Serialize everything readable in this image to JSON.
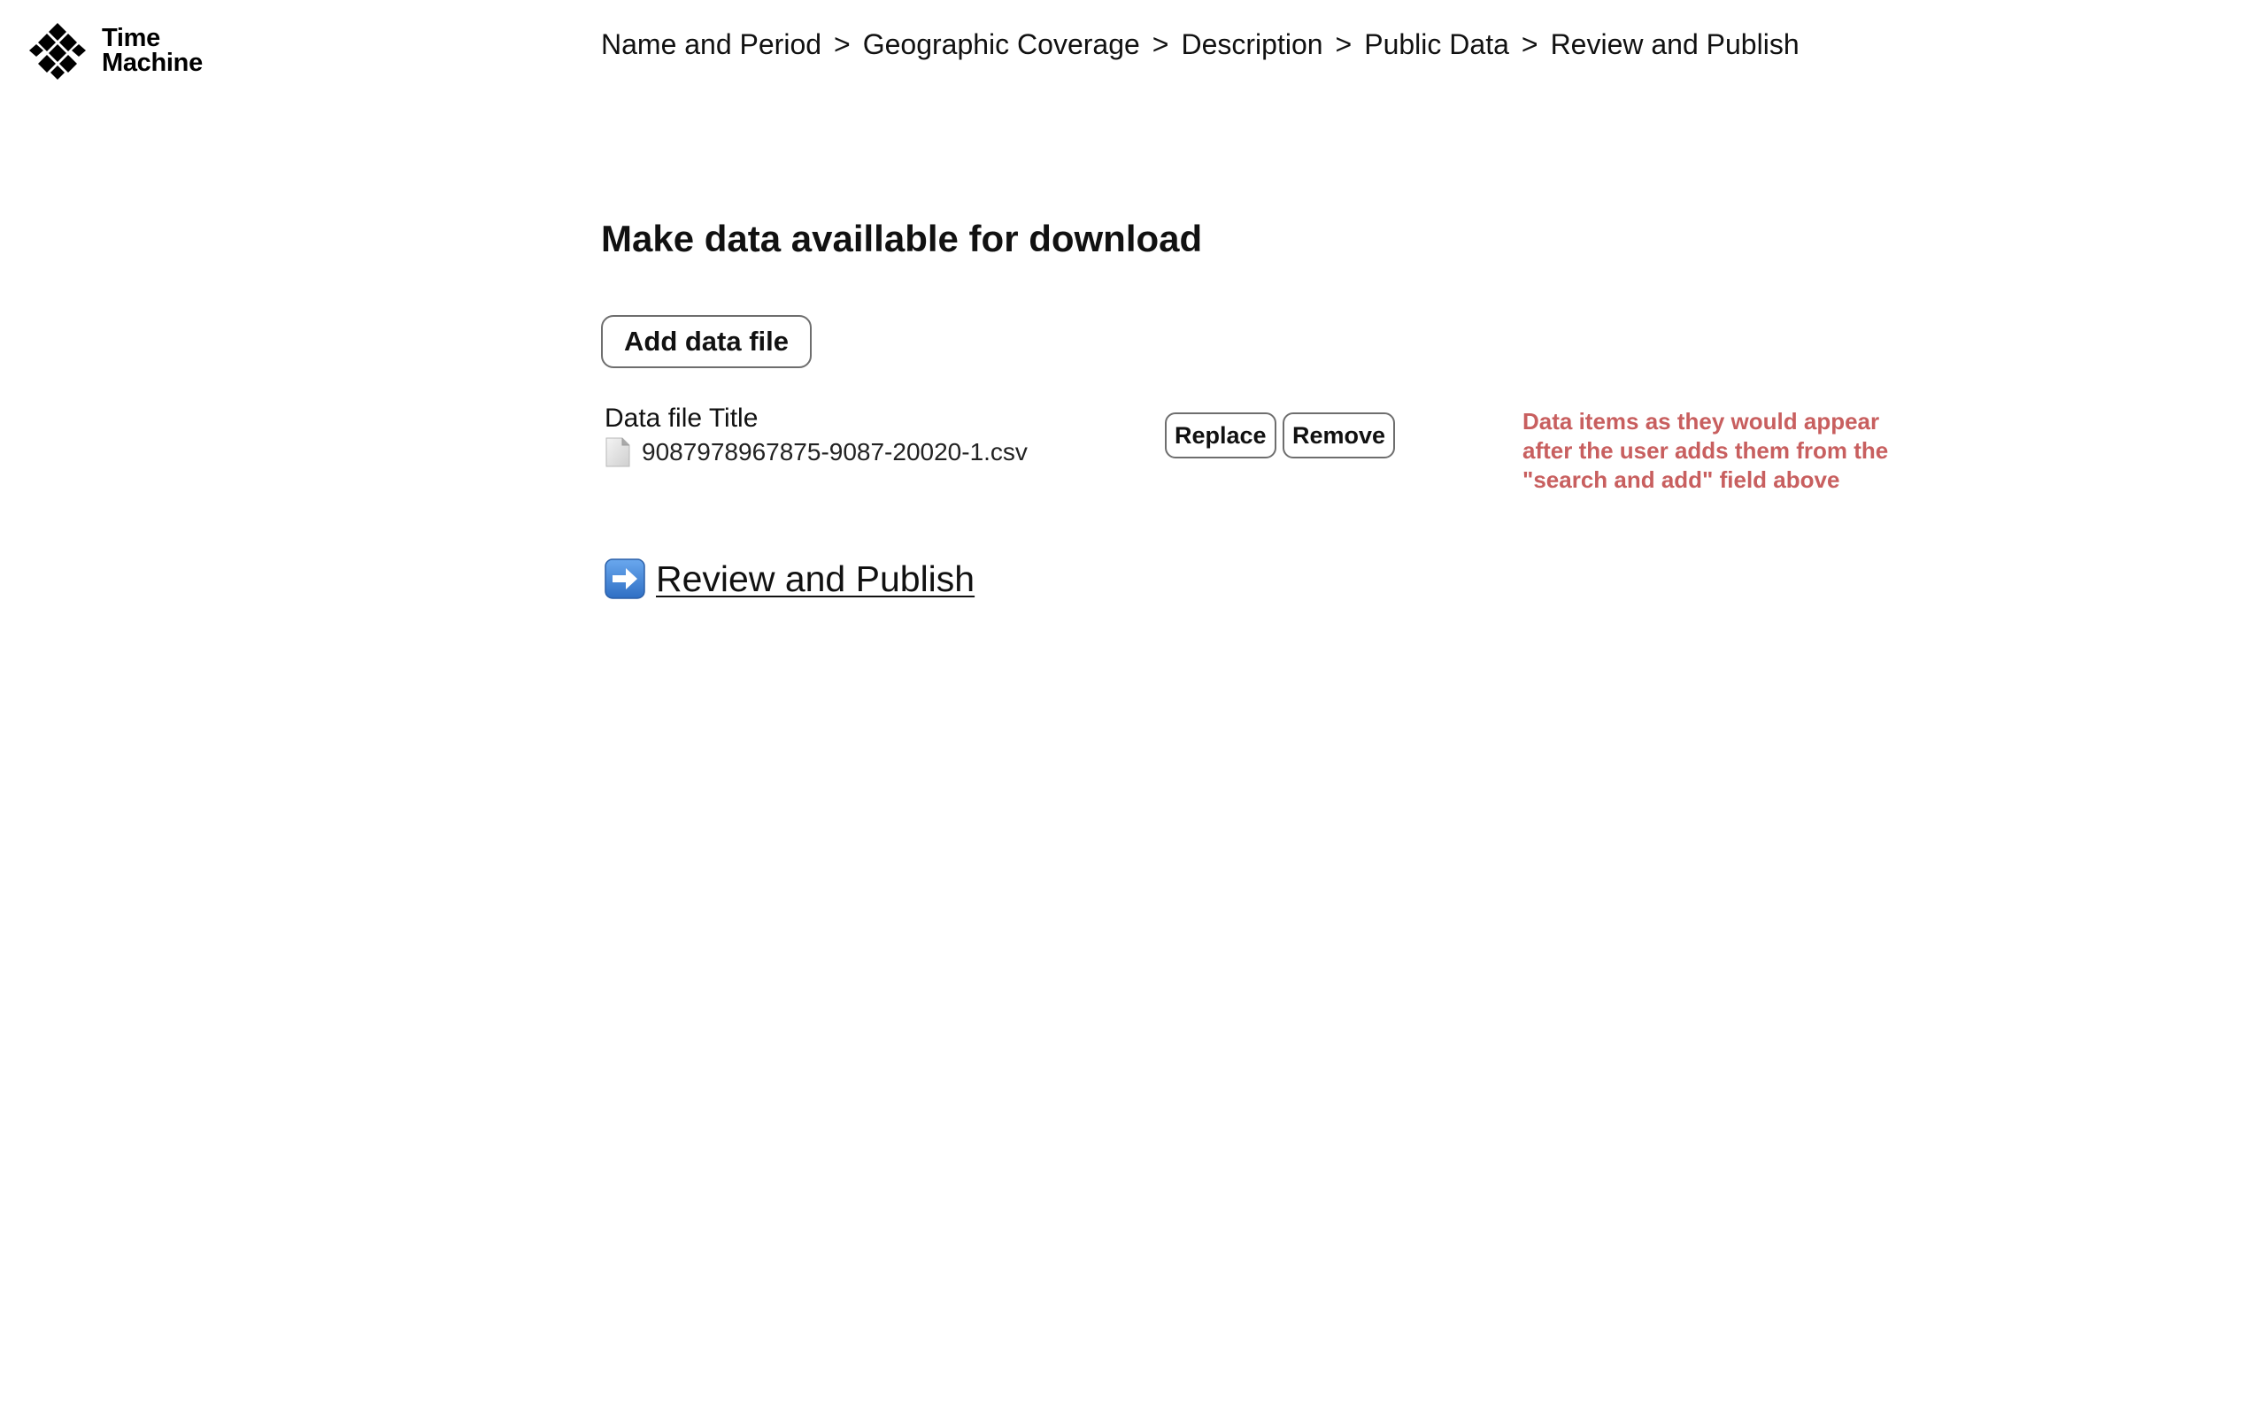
{
  "brand": {
    "line1": "Time",
    "line2": "Machine"
  },
  "breadcrumb": {
    "separator": ">",
    "items": [
      {
        "label": "Name and Period"
      },
      {
        "label": "Geographic Coverage"
      },
      {
        "label": "Description"
      },
      {
        "label": "Public Data"
      },
      {
        "label": "Review and Publish"
      }
    ]
  },
  "main": {
    "title": "Make data availlable for download",
    "add_button_label": "Add data file",
    "file_item": {
      "title": "Data file Title",
      "filename": "9087978967875-9087-20020-1.csv",
      "replace_label": "Replace",
      "remove_label": "Remove"
    },
    "annotation": "Data items as they would appear after the user adds them from the \"search and add\" field above",
    "next_link_label": "Review and Publish"
  },
  "icons": {
    "logo": "diamond-grid-icon",
    "file": "document-icon",
    "next": "arrow-right-icon"
  },
  "colors": {
    "annotation": "#c85f5f",
    "arrow_button": "#3b7fd6"
  }
}
